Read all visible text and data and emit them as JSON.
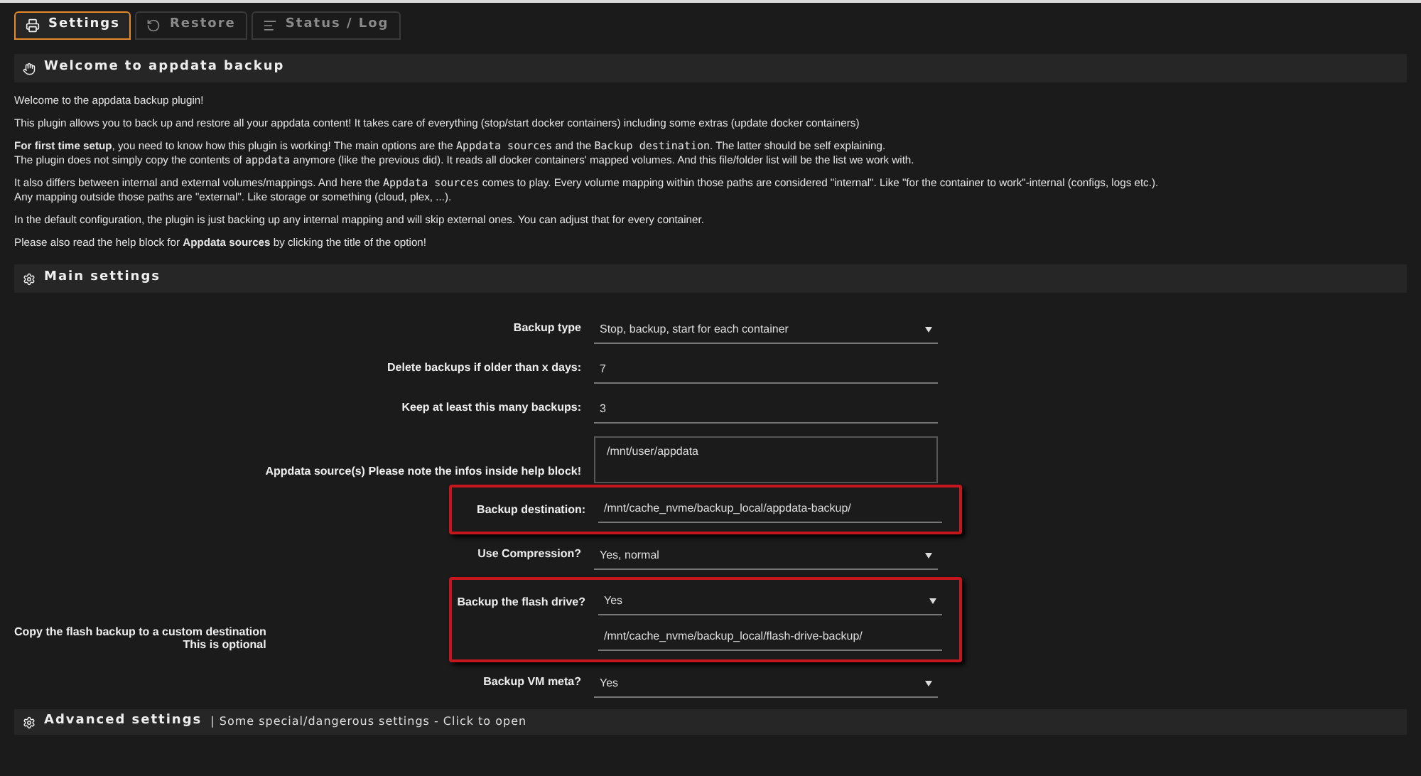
{
  "tabs": [
    {
      "label": "Settings",
      "selected": true
    },
    {
      "label": "Restore",
      "selected": false
    },
    {
      "label": "Status / Log",
      "selected": false
    }
  ],
  "welcome": {
    "title": "Welcome to appdata backup",
    "paragraphs": [
      [
        [
          {
            "kind": "text",
            "text": "Welcome to the appdata backup plugin!"
          }
        ]
      ],
      [
        [
          {
            "kind": "text",
            "text": "This plugin allows you to back up and restore all your appdata content! It takes care of everything (stop/start docker containers) including some extras (update docker containers)"
          }
        ]
      ],
      [
        [
          {
            "kind": "bold",
            "text": "For first time setup"
          },
          {
            "kind": "text",
            "text": ", you need to know how this plugin is working! The main options are the "
          },
          {
            "kind": "code",
            "text": "Appdata sources"
          },
          {
            "kind": "text",
            "text": " and the "
          },
          {
            "kind": "code",
            "text": "Backup destination"
          },
          {
            "kind": "text",
            "text": ". The latter should be self explaining."
          }
        ],
        [
          {
            "kind": "text",
            "text": "The plugin does not simply copy the contents of "
          },
          {
            "kind": "code",
            "text": "appdata"
          },
          {
            "kind": "text",
            "text": " anymore (like the previous did). It reads all docker containers' mapped volumes. And this file/folder list will be the list we work with."
          }
        ]
      ],
      [
        [
          {
            "kind": "text",
            "text": "It also differs between internal and external volumes/mappings. And here the "
          },
          {
            "kind": "code",
            "text": "Appdata sources"
          },
          {
            "kind": "text",
            "text": " comes to play. Every volume mapping within those paths are considered \"internal\". Like \"for the container to work\"-internal (configs, logs etc.)."
          }
        ],
        [
          {
            "kind": "text",
            "text": "Any mapping outside those paths are \"external\". Like storage or something (cloud, plex, ...)."
          }
        ]
      ],
      [
        [
          {
            "kind": "text",
            "text": "In the default configuration, the plugin is just backing up any internal mapping and will skip external ones. You can adjust that for every container."
          }
        ]
      ],
      [
        [
          {
            "kind": "text",
            "text": "Please also read the help block for "
          },
          {
            "kind": "bold",
            "text": "Appdata sources"
          },
          {
            "kind": "text",
            "text": " by clicking the title of the option!"
          }
        ]
      ]
    ]
  },
  "main_settings": {
    "title": "Main settings",
    "groups": [
      {
        "highlighted": false,
        "rows": [
          {
            "kind": "select",
            "label": "Backup type",
            "value": "Stop, backup, start for each container"
          }
        ]
      },
      {
        "highlighted": false,
        "rows": [
          {
            "kind": "input",
            "label": "Delete backups if older than x days:",
            "value": "7"
          }
        ]
      },
      {
        "highlighted": false,
        "rows": [
          {
            "kind": "input",
            "label": "Keep at least this many backups:",
            "value": "3"
          }
        ]
      },
      {
        "highlighted": false,
        "rows": [
          {
            "kind": "textarea",
            "label": "Appdata source(s) Please note the infos inside help block!",
            "value": "/mnt/user/appdata"
          }
        ]
      },
      {
        "highlighted": true,
        "rows": [
          {
            "kind": "input",
            "label": "Backup destination:",
            "value": "/mnt/cache_nvme/backup_local/appdata-backup/"
          }
        ]
      },
      {
        "highlighted": false,
        "rows": [
          {
            "kind": "select",
            "label": "Use Compression?",
            "value": "Yes, normal"
          }
        ]
      },
      {
        "highlighted": true,
        "rows": [
          {
            "kind": "select",
            "label": "Backup the flash drive?",
            "value": "Yes"
          },
          {
            "kind": "input",
            "outside_label": [
              "Copy the flash backup to a custom destination",
              "This is optional"
            ],
            "value": "/mnt/cache_nvme/backup_local/flash-drive-backup/"
          }
        ]
      },
      {
        "highlighted": false,
        "rows": [
          {
            "kind": "select",
            "label": "Backup VM meta?",
            "value": "Yes"
          }
        ]
      }
    ]
  },
  "advanced": {
    "title": "Advanced settings",
    "subtitle": "| Some special/dangerous settings - Click to open"
  }
}
